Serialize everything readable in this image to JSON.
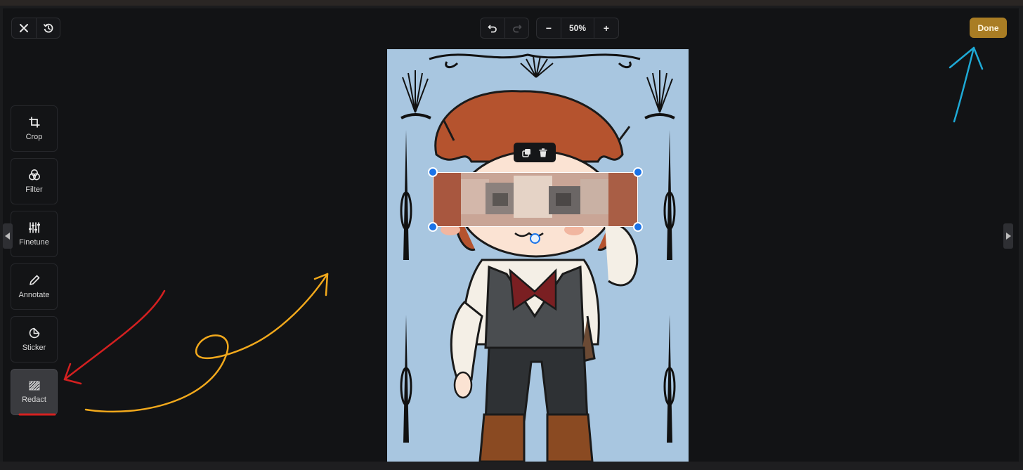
{
  "toolbar_left": {
    "close_icon": "close-icon",
    "history_icon": "history-icon"
  },
  "toolbar_center": {
    "undo_icon": "undo-icon",
    "redo_icon": "redo-icon",
    "zoom_out_label": "−",
    "zoom_level": "50%",
    "zoom_in_label": "+"
  },
  "done_label": "Done",
  "tools": [
    {
      "label": "Crop",
      "icon": "crop-icon"
    },
    {
      "label": "Filter",
      "icon": "filter-icon"
    },
    {
      "label": "Finetune",
      "icon": "sliders-icon"
    },
    {
      "label": "Annotate",
      "icon": "pencil-icon"
    },
    {
      "label": "Sticker",
      "icon": "sticker-icon"
    },
    {
      "label": "Redact",
      "icon": "redact-icon",
      "active": true
    }
  ],
  "selection_toolbar": {
    "duplicate_icon": "duplicate-icon",
    "delete_icon": "trash-icon"
  },
  "colors": {
    "accent_done": "#a97d24",
    "handle_blue": "#1a73e8",
    "annotation_red": "#d42020",
    "annotation_orange": "#f2a91c",
    "annotation_blue": "#1eaad6",
    "canvas_bg": "#a8c6e0"
  }
}
